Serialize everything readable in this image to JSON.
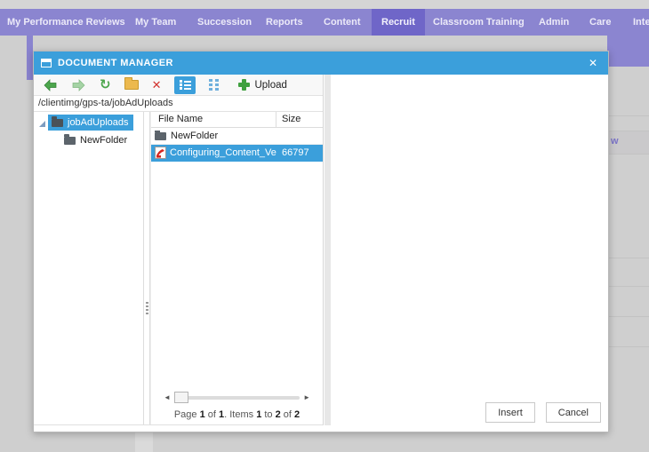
{
  "nav": {
    "items": [
      {
        "label": "My Performance Reviews"
      },
      {
        "label": "My Team"
      },
      {
        "label": "Succession"
      },
      {
        "label": "Reports"
      },
      {
        "label": "Content"
      },
      {
        "label": "Recruit",
        "active": true
      },
      {
        "label": "Classroom Training"
      },
      {
        "label": "Admin"
      },
      {
        "label": "Care"
      },
      {
        "label": "Inte"
      }
    ]
  },
  "background": {
    "partial_link_text": "w"
  },
  "dialog": {
    "title": "DOCUMENT MANAGER",
    "close_icon": "✕",
    "toolbar": {
      "icons": {
        "refresh": "↻",
        "delete": "✕",
        "scroll_left": "◄",
        "scroll_right": "►"
      },
      "upload_label": "Upload"
    },
    "address": "/clientimg/gps-ta/jobAdUploads",
    "tree": {
      "root": "jobAdUploads",
      "children": [
        "NewFolder"
      ]
    },
    "list": {
      "columns": [
        "File Name",
        "Size"
      ],
      "rows": [
        {
          "name": "NewFolder",
          "size": "",
          "type": "folder",
          "selected": false
        },
        {
          "name": "Configuring_Content_Vendo",
          "size": "66797",
          "type": "pdf",
          "selected": true
        }
      ]
    },
    "pager": {
      "parts": [
        {
          "t": "Page "
        },
        {
          "t": "1"
        },
        {
          "t": " of "
        },
        {
          "t": "1"
        },
        {
          "t": ". Items "
        },
        {
          "t": "1"
        },
        {
          "t": " to "
        },
        {
          "t": "2"
        },
        {
          "t": " of "
        },
        {
          "t": "2"
        }
      ]
    },
    "buttons": {
      "insert": "Insert",
      "cancel": "Cancel"
    }
  },
  "colors": {
    "titlebar_blue": "#3b9fdb",
    "selection_blue": "#3b9fdb",
    "nav_purple": "#8b85d0",
    "nav_active_purple": "#6f66c8",
    "backdrop_gray": "#cfcfcf"
  }
}
